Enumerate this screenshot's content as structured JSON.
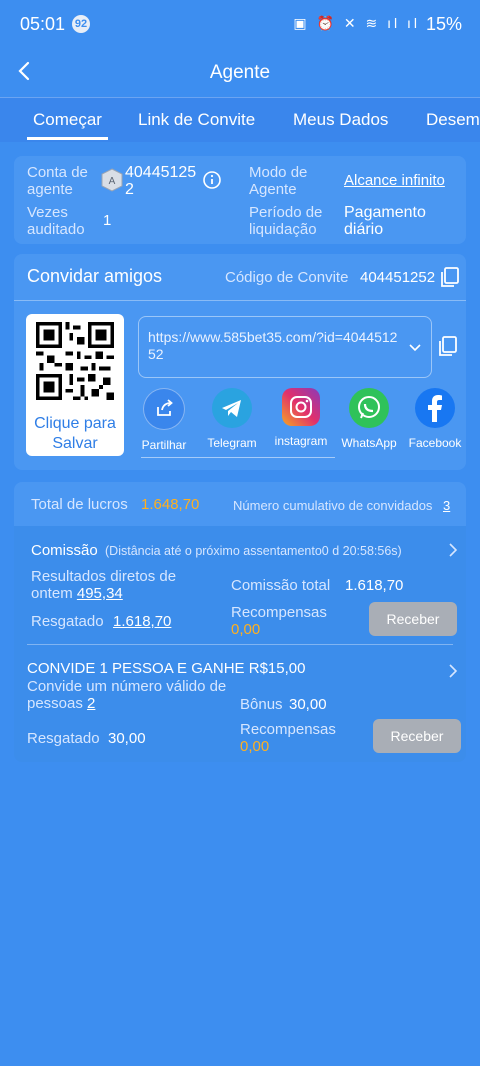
{
  "status": {
    "time": "05:01",
    "badge": "92",
    "icons": "▣ ⏰ ✕ ≋ ıl ıl",
    "battery": "15%"
  },
  "header": {
    "title": "Agente"
  },
  "tabs": [
    "Começar",
    "Link de Convite",
    "Meus Dados",
    "Desem"
  ],
  "agent": {
    "account_label": "Conta de agente",
    "account_value": "40445125 2",
    "level": "A",
    "mode_label": "Modo de Agente",
    "mode_value": "Alcance infinito",
    "audited_label": "Vezes auditado",
    "audited_value": "1",
    "period_label": "Período de liquidação",
    "period_value": "Pagamento diário"
  },
  "invite": {
    "title": "Convidar amigos",
    "code_label": "Código de Convite",
    "code_value": "404451252",
    "qr_label": "Clique para Salvar",
    "url": "https://www.585bet35.com/?id=404451252",
    "share": [
      {
        "name": "Partilhar",
        "icon": "share-icon",
        "color": "#3a86ec"
      },
      {
        "name": "Telegram",
        "icon": "telegram-icon",
        "color": "#2aa3e0"
      },
      {
        "name": "instagram",
        "icon": "instagram-icon",
        "color": "#d62f7a"
      },
      {
        "name": "WhatsApp",
        "icon": "whatsapp-icon",
        "color": "#2fc25a"
      },
      {
        "name": "Facebook",
        "icon": "facebook-icon",
        "color": "#1877f2"
      }
    ]
  },
  "stats": {
    "profit_label": "Total de lucros",
    "profit_value": "1.648,70",
    "invited_label": "Número cumulativo de convidados",
    "invited_value": "3"
  },
  "commission": {
    "title": "Comissão",
    "countdown": "(Distância até o próximo assentamento0 d 20:58:56s)",
    "direct_label": "Resultados diretos de ontem",
    "direct_value": "495,34",
    "total_label": "Comissão total",
    "total_value": "1.618,70",
    "redeemed_label": "Resgatado",
    "redeemed_value": "1.618,70",
    "reward_label": "Recompensas",
    "reward_value": "0,00",
    "button": "Receber"
  },
  "promo": {
    "title": "CONVIDE 1 PESSOA E GANHE R$15,00",
    "desc_label": "Convide um número válido de pessoas",
    "desc_value": "2",
    "bonus_label": "Bônus",
    "bonus_value": "30,00",
    "redeemed_label": "Resgatado",
    "redeemed_value": "30,00",
    "reward_label": "Recompensas",
    "reward_value": "0,00",
    "button": "Receber"
  }
}
